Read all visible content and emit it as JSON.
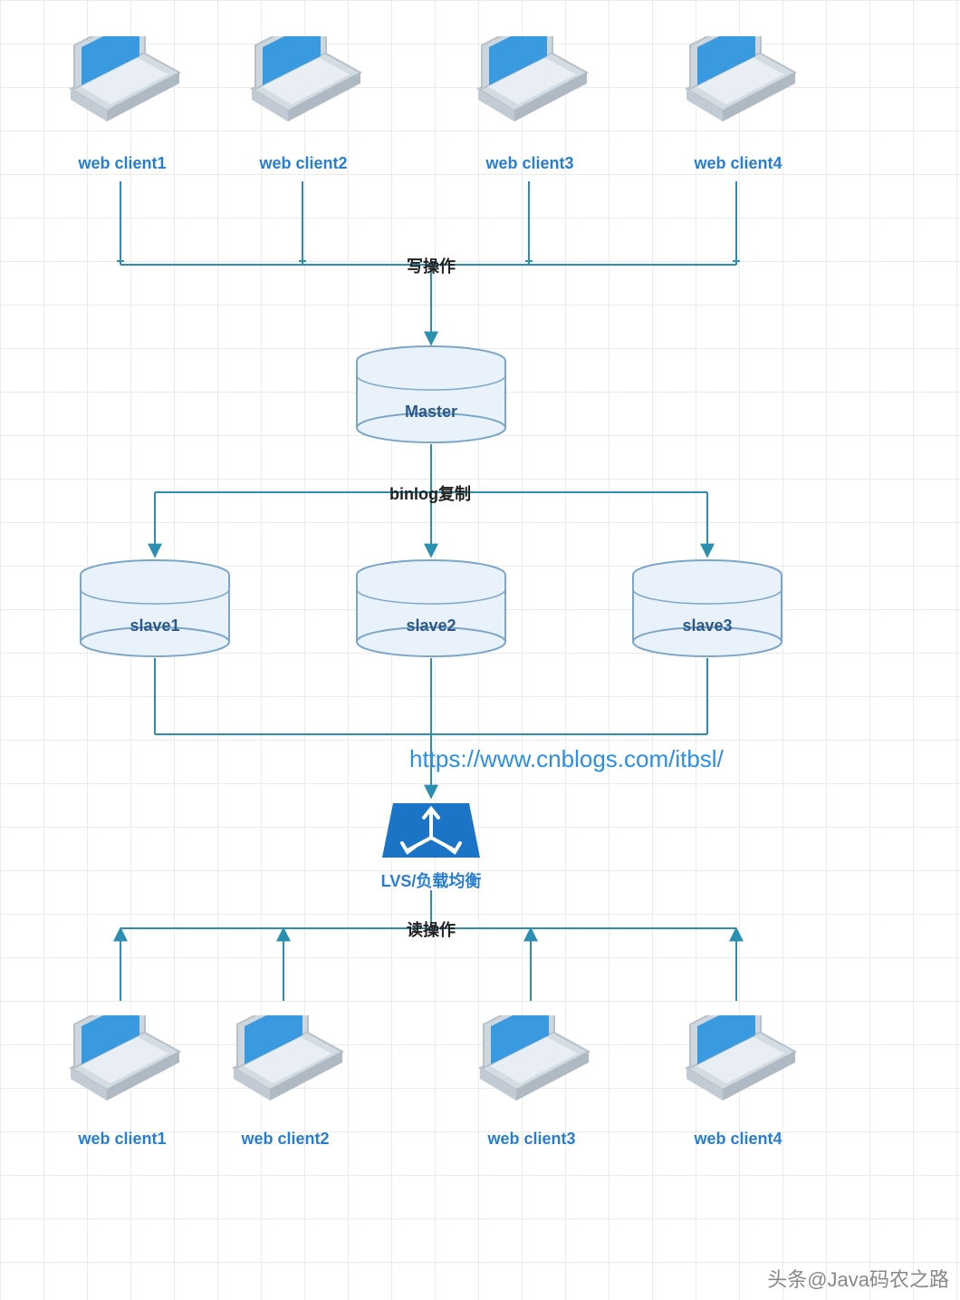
{
  "clients_top": [
    {
      "label": "web client1"
    },
    {
      "label": "web client2"
    },
    {
      "label": "web client3"
    },
    {
      "label": "web client4"
    }
  ],
  "clients_bottom": [
    {
      "label": "web client1"
    },
    {
      "label": "web client2"
    },
    {
      "label": "web client3"
    },
    {
      "label": "web client4"
    }
  ],
  "master": {
    "label": "Master"
  },
  "slaves": [
    {
      "label": "slave1"
    },
    {
      "label": "slave2"
    },
    {
      "label": "slave3"
    }
  ],
  "lvs": {
    "label": "LVS/负载均衡"
  },
  "edges": {
    "write": "写操作",
    "binlog": "binlog复制",
    "read": "读操作"
  },
  "url": "https://www.cnblogs.com/itbsl/",
  "credit": "头条@Java码农之路",
  "colors": {
    "primary": "#267ed3",
    "line": "#2a8fb0",
    "dbFill": "#e9f1fa",
    "dbStroke": "#7aa6c9",
    "lvsFill": "#1b74c5"
  }
}
